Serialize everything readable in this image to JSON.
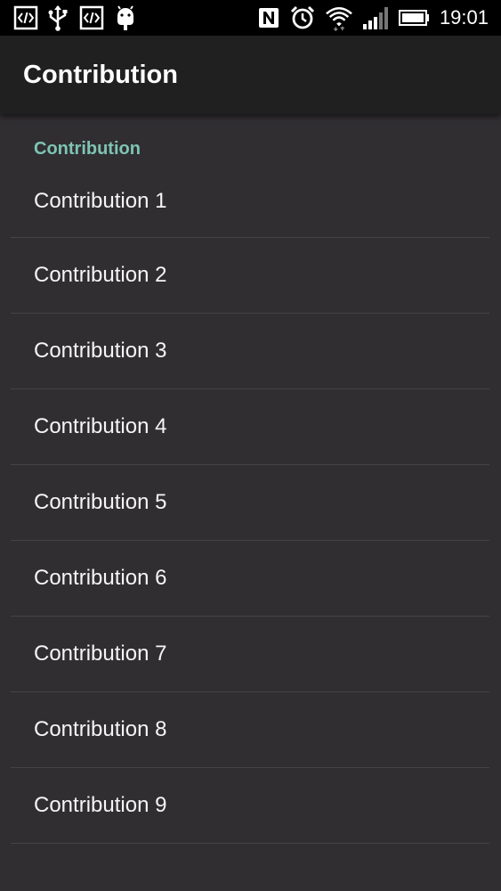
{
  "status_bar": {
    "time": "19:01",
    "icons": [
      "code-icon",
      "usb-icon",
      "code-icon",
      "android-icon",
      "nfc-icon",
      "alarm-icon",
      "wifi-icon",
      "signal-icon",
      "battery-icon"
    ]
  },
  "app_bar": {
    "title": "Contribution"
  },
  "content": {
    "category_title": "Contribution",
    "items": [
      {
        "label": "Contribution 1"
      },
      {
        "label": "Contribution 2"
      },
      {
        "label": "Contribution 3"
      },
      {
        "label": "Contribution 4"
      },
      {
        "label": "Contribution 5"
      },
      {
        "label": "Contribution 6"
      },
      {
        "label": "Contribution 7"
      },
      {
        "label": "Contribution 8"
      },
      {
        "label": "Contribution 9"
      }
    ]
  },
  "colors": {
    "status_bar": "#000000",
    "app_bar": "#212021",
    "background": "#302e31",
    "accent": "#7ec4b4",
    "divider": "#454346"
  }
}
